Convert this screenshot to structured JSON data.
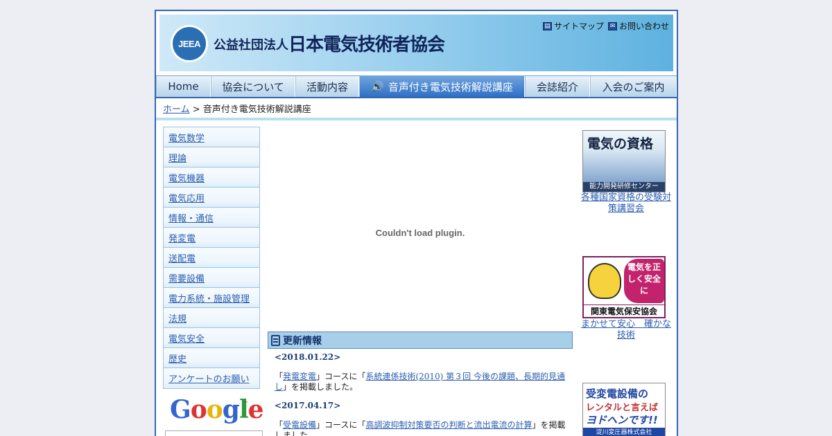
{
  "header": {
    "logo_text": "JEEA",
    "org_prefix": "公益社団法人",
    "org_name": "日本電気技術者協会",
    "sitemap_label": "サイトマップ",
    "contact_label": "お問い合わせ"
  },
  "nav": [
    {
      "label": "Home"
    },
    {
      "label": "協会について"
    },
    {
      "label": "活動内容"
    },
    {
      "label": "音声付き電気技術解説講座",
      "active": true
    },
    {
      "label": "会誌紹介"
    },
    {
      "label": "入会のご案内"
    }
  ],
  "breadcrumb": {
    "home": "ホーム",
    "separator": " > ",
    "current": "音声付き電気技術解説講座"
  },
  "sidebar": {
    "items": [
      {
        "label": "電気数学"
      },
      {
        "label": "理論"
      },
      {
        "label": "電気機器"
      },
      {
        "label": "電気応用"
      },
      {
        "label": "情報・通信"
      },
      {
        "label": "発変電"
      },
      {
        "label": "送配電"
      },
      {
        "label": "需要設備"
      },
      {
        "label": "電力系統・施設管理"
      },
      {
        "label": "法規"
      },
      {
        "label": "電気安全"
      },
      {
        "label": "歴史"
      },
      {
        "label": "アンケートのお願い"
      }
    ],
    "google_logo": "Google",
    "google_tm": "™"
  },
  "main": {
    "plugin_message": "Couldn't load plugin.",
    "updates_title": "更新情報",
    "updates": [
      {
        "date": "<2018.01.22>",
        "open": "「",
        "category": "発電変電",
        "mid": "」コースに「",
        "title": "系統連係技術(2010) 第３回 今後の課題、長期的見通し",
        "tail": "」を掲載しました。"
      },
      {
        "date": "<2017.04.17>",
        "open": "「",
        "category": "受電設備",
        "mid": "」コースに「",
        "title": "高調波抑制対策要否の判断と流出電流の計算",
        "tail": "」を掲載しました。"
      }
    ]
  },
  "right": {
    "banner1": {
      "title": "電気の資格",
      "subtitle": "能力開発研修センター",
      "caption": "各種国家資格の受験対策講習会"
    },
    "banner2": {
      "bubble": "電気を正しく安全に",
      "name": "関東電気保安協会",
      "caption": "まかせて安心　確かな技術"
    },
    "banner3": {
      "line1": "受変電設備の",
      "line2": "レンタルと言えば",
      "line3": "ヨドヘンです!!",
      "line4": "淀川変圧器株式会社"
    }
  }
}
